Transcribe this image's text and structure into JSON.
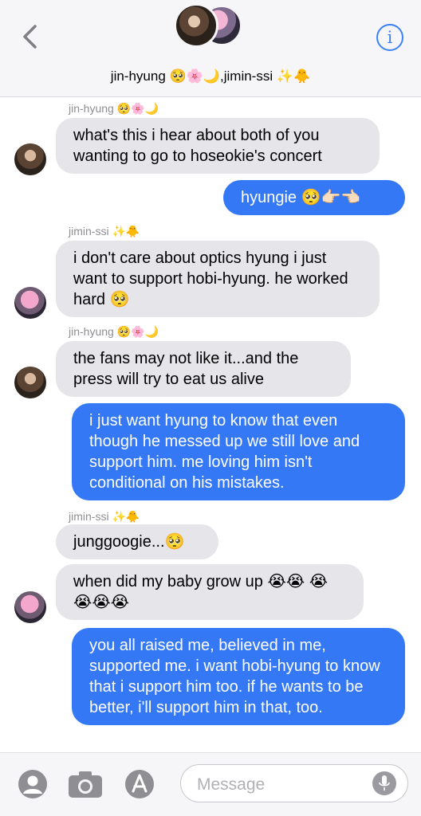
{
  "header": {
    "title": "jin-hyung 🥺🌸🌙,jimin-ssi ✨🐥",
    "back_icon": "chevron-left-icon",
    "info_label": "i"
  },
  "messages": [
    {
      "sender": "jin-hyung 🥺🌸🌙",
      "from": "jin",
      "text": "what's this i hear about both of you wanting to go to hoseokie's concert"
    },
    {
      "from": "me",
      "text": "hyungie 🥺👉🏻👈🏻"
    },
    {
      "sender": "jimin-ssi ✨🐥",
      "from": "jimin",
      "text": "i don't care about optics hyung i just want to support hobi-hyung. he worked hard 🥺"
    },
    {
      "sender": "jin-hyung 🥺🌸🌙",
      "from": "jin",
      "text": "the fans may not like it...and the press will try to eat us alive"
    },
    {
      "from": "me",
      "text": "i just want hyung to know that even though he messed up we still love and support him. me loving him isn't conditional on his mistakes."
    },
    {
      "sender": "jimin-ssi ✨🐥",
      "from": "jimin",
      "text": "junggoogie...🥺"
    },
    {
      "from": "jimin",
      "text": "when did my baby grow up 😭😭 😭😭😭😭"
    },
    {
      "from": "me",
      "text": "you all raised me, believed in me, supported me. i want hobi-hyung to know that i support him too. if he wants to be better, i'll support him in that, too."
    }
  ],
  "composer": {
    "placeholder": "Message",
    "icons": [
      "contact-icon",
      "camera-icon",
      "app-store-icon",
      "microphone-icon"
    ]
  },
  "colors": {
    "outgoing_bubble": "#3478f6",
    "incoming_bubble": "#e5e5ea",
    "accent": "#3a82f7"
  }
}
